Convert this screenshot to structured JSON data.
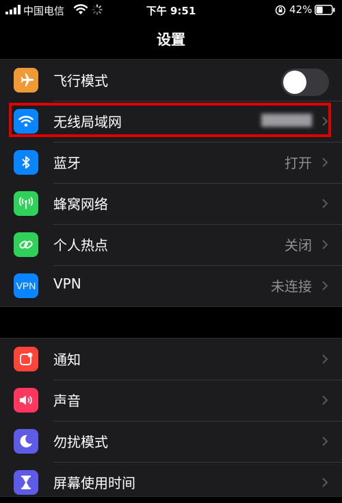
{
  "status_bar": {
    "carrier": "中国电信",
    "time": "下午 9:51",
    "battery": "42%",
    "battery_level": 0.42
  },
  "nav": {
    "title": "设置"
  },
  "groups": [
    {
      "rows": [
        {
          "label": "飞行模式",
          "icon": "airplane-icon",
          "icon_color": "#f09a37",
          "toggle": false
        },
        {
          "label": "无线局域网",
          "icon": "wifi-icon",
          "icon_color": "#0a84ff",
          "value": "██████",
          "highlighted": true
        },
        {
          "label": "蓝牙",
          "icon": "bluetooth-icon",
          "icon_color": "#0a84ff",
          "value": "打开"
        },
        {
          "label": "蜂窝网络",
          "icon": "cellular-icon",
          "icon_color": "#30d158"
        },
        {
          "label": "个人热点",
          "icon": "hotspot-icon",
          "icon_color": "#30d158",
          "value": "关闭"
        },
        {
          "label": "VPN",
          "icon": "vpn-icon",
          "icon_text": "VPN",
          "icon_color": "#0a84ff",
          "value": "未连接"
        }
      ]
    },
    {
      "rows": [
        {
          "label": "通知",
          "icon": "notifications-icon",
          "icon_color": "#ff453a"
        },
        {
          "label": "声音",
          "icon": "sound-icon",
          "icon_color": "#ff375f"
        },
        {
          "label": "勿扰模式",
          "icon": "moon-icon",
          "icon_color": "#5e5ce6"
        },
        {
          "label": "屏幕使用时间",
          "icon": "hourglass-icon",
          "icon_color": "#5e5ce6"
        }
      ]
    }
  ],
  "colors": {
    "background": "#000000",
    "cell_background": "#1c1c1e",
    "secondary_text": "#8e8e93",
    "highlight_border": "#e00000"
  }
}
